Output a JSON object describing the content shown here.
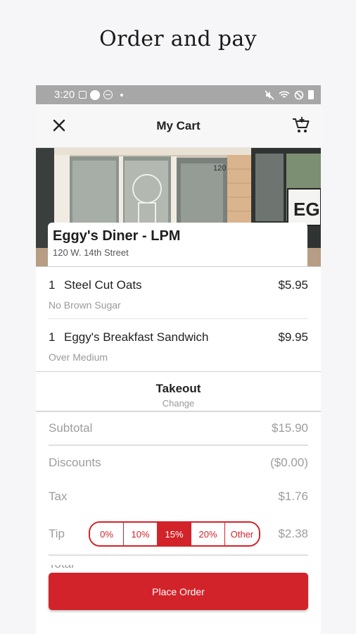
{
  "headline": "Order and pay",
  "status_bar": {
    "time": "3:20"
  },
  "app_bar": {
    "title": "My Cart"
  },
  "restaurant": {
    "name": "Eggy's Diner - LPM",
    "address": "120 W. 14th Street",
    "sign_number": "120",
    "sign_text": "EG"
  },
  "cart_items": [
    {
      "qty": "1",
      "name": "Steel Cut Oats",
      "price": "$5.95",
      "modifier": "No Brown Sugar"
    },
    {
      "qty": "1",
      "name": "Eggy's Breakfast Sandwich",
      "price": "$9.95",
      "modifier": "Over Medium"
    }
  ],
  "order_method": {
    "title": "Takeout",
    "change_label": "Change"
  },
  "totals": {
    "subtotal_label": "Subtotal",
    "subtotal": "$15.90",
    "discounts_label": "Discounts",
    "discounts": "($0.00)",
    "tax_label": "Tax",
    "tax": "$1.76",
    "tip_label": "Tip",
    "tip": "$2.38",
    "tip_options": [
      "0%",
      "10%",
      "15%",
      "20%",
      "Other"
    ],
    "tip_selected": "15%",
    "total_label": "Total"
  },
  "place_order_label": "Place Order",
  "colors": {
    "accent": "#d2232a",
    "status_bar": "#a7a7a7"
  }
}
